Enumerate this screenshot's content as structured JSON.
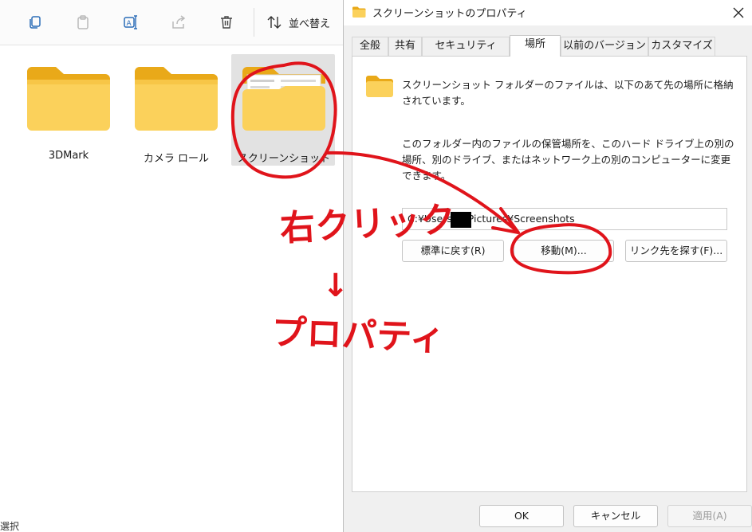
{
  "explorer": {
    "toolbar": {
      "copy_icon": "copy-icon",
      "paste_icon": "paste-icon",
      "rename_icon": "rename-icon",
      "share_icon": "share-icon",
      "delete_icon": "trash-icon",
      "sort_label": "並べ替え"
    },
    "items": [
      {
        "label": "3DMark"
      },
      {
        "label": "カメラ ロール"
      },
      {
        "label": "スクリーンショット"
      }
    ],
    "status": "選択"
  },
  "dialog": {
    "title": "スクリーンショットのプロパティ",
    "tabs": [
      "全般",
      "共有",
      "セキュリティ",
      "場所",
      "以前のバージョン",
      "カスタマイズ"
    ],
    "active_tab": "場所",
    "description1": "スクリーンショット フォルダーのファイルは、以下のあて先の場所に格納されています。",
    "description2": "このフォルダー内のファイルの保管場所を、このハード ドライブ上の別の場所、別のドライブ、またはネットワーク上の別のコンピューターに変更できます。",
    "path": "C:¥Users¥      ¥Pictures¥Screenshots",
    "buttons": {
      "restore": "標準に戻す(R)",
      "move": "移動(M)...",
      "find_target": "リンク先を探す(F)..."
    },
    "footer": {
      "ok": "OK",
      "cancel": "キャンセル",
      "apply": "適用(A)"
    }
  },
  "annotation": {
    "line1": "右クリック",
    "arrow": "↓",
    "line2": "プロパティ",
    "color": "#e0141b"
  }
}
